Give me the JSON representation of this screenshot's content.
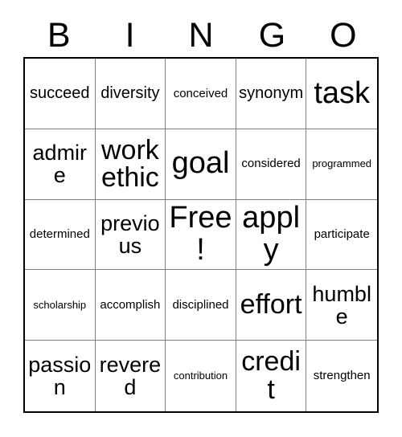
{
  "card": {
    "header_letters": [
      "B",
      "I",
      "N",
      "G",
      "O"
    ],
    "free_space_text": "Free!",
    "colors": {
      "background": "#ffffff",
      "text": "#000000",
      "outer_border": "#000000",
      "inner_border": "#808080"
    },
    "grid_size": "5x5",
    "cells": [
      {
        "text": "succeed",
        "size": "sm"
      },
      {
        "text": "diversity",
        "size": "sm"
      },
      {
        "text": "conceived",
        "size": "xs"
      },
      {
        "text": "synonym",
        "size": "sm"
      },
      {
        "text": "task",
        "size": "xl"
      },
      {
        "text": "admire",
        "size": "md"
      },
      {
        "text": "work ethic",
        "size": "lg"
      },
      {
        "text": "goal",
        "size": "xl"
      },
      {
        "text": "considered",
        "size": "xs"
      },
      {
        "text": "programmed",
        "size": "xxs"
      },
      {
        "text": "determined",
        "size": "xs"
      },
      {
        "text": "previous",
        "size": "md"
      },
      {
        "text": "Free!",
        "size": "xl"
      },
      {
        "text": "apply",
        "size": "xl"
      },
      {
        "text": "participate",
        "size": "xs"
      },
      {
        "text": "scholarship",
        "size": "xxs"
      },
      {
        "text": "accomplish",
        "size": "xs"
      },
      {
        "text": "disciplined",
        "size": "xs"
      },
      {
        "text": "effort",
        "size": "lg"
      },
      {
        "text": "humble",
        "size": "md"
      },
      {
        "text": "passion",
        "size": "md"
      },
      {
        "text": "revered",
        "size": "md"
      },
      {
        "text": "contribution",
        "size": "xxs"
      },
      {
        "text": "credit",
        "size": "lg"
      },
      {
        "text": "strengthen",
        "size": "xs"
      }
    ]
  }
}
